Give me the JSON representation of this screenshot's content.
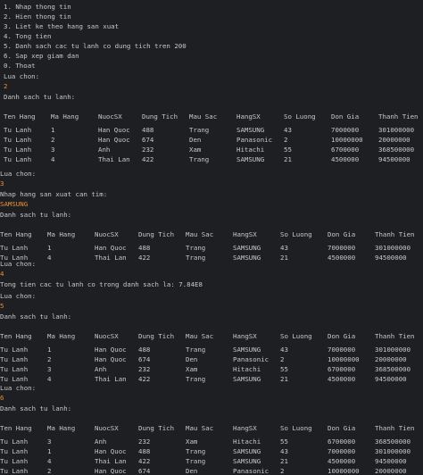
{
  "theme": {
    "bg": "#1e1f22",
    "text": "#c8c8c8",
    "input": "#e8922e"
  },
  "menu": [
    "1. Nhap thong tin",
    "2. Hien thong tin",
    "3. Liet ke theo hang san xuat",
    "4. Tong tien",
    "5. Danh sach cac tu lanh co dung tich tren 200",
    "6. Sap xep giam dan",
    "0. Thoat"
  ],
  "prompt": "Lua chon:",
  "list_title": "Danh sach tu lanh:",
  "search_prompt": "Nhap hang san xuat can tim:",
  "total_text": "Tong tien cac tu lanh co trong danh sach la: 7.84E8",
  "inputs": {
    "c1": "2",
    "c2": "3",
    "c3": "SAMSUNG",
    "c4": "4",
    "c5": "5",
    "c6": "6"
  },
  "headers": [
    "Ten Hang",
    "Ma Hang",
    "NuocSX",
    "Dung Tich",
    "Mau Sac",
    "HangSX",
    "So Luong",
    "Don Gia",
    "Thanh Tien"
  ],
  "tables": {
    "all": [
      [
        "Tu Lanh",
        "1",
        "Han Quoc",
        "488",
        "Trang",
        "SAMSUNG",
        "43",
        "7000000",
        "301000000"
      ],
      [
        "Tu Lanh",
        "2",
        "Han Quoc",
        "674",
        "Den",
        "Panasonic",
        "2",
        "10000000",
        "20000000"
      ],
      [
        "Tu Lanh",
        "3",
        "Anh",
        "232",
        "Xam",
        "Hitachi",
        "55",
        "6700000",
        "368500000"
      ],
      [
        "Tu Lanh",
        "4",
        "Thai Lan",
        "422",
        "Trang",
        "SAMSUNG",
        "21",
        "4500000",
        "94500000"
      ]
    ],
    "samsung": [
      [
        "Tu Lanh",
        "1",
        "Han Quoc",
        "488",
        "Trang",
        "SAMSUNG",
        "43",
        "7000000",
        "301000000"
      ],
      [
        "Tu Lanh",
        "4",
        "Thai Lan",
        "422",
        "Trang",
        "SAMSUNG",
        "21",
        "4500000",
        "94500000"
      ]
    ],
    "sorted": [
      [
        "Tu Lanh",
        "3",
        "Anh",
        "232",
        "Xam",
        "Hitachi",
        "55",
        "6700000",
        "368500000"
      ],
      [
        "Tu Lanh",
        "1",
        "Han Quoc",
        "488",
        "Trang",
        "SAMSUNG",
        "43",
        "7000000",
        "301000000"
      ],
      [
        "Tu Lanh",
        "4",
        "Thai Lan",
        "422",
        "Trang",
        "SAMSUNG",
        "21",
        "4500000",
        "94500000"
      ],
      [
        "Tu Lanh",
        "2",
        "Han Quoc",
        "674",
        "Den",
        "Panasonic",
        "2",
        "10000000",
        "20000000"
      ]
    ]
  }
}
